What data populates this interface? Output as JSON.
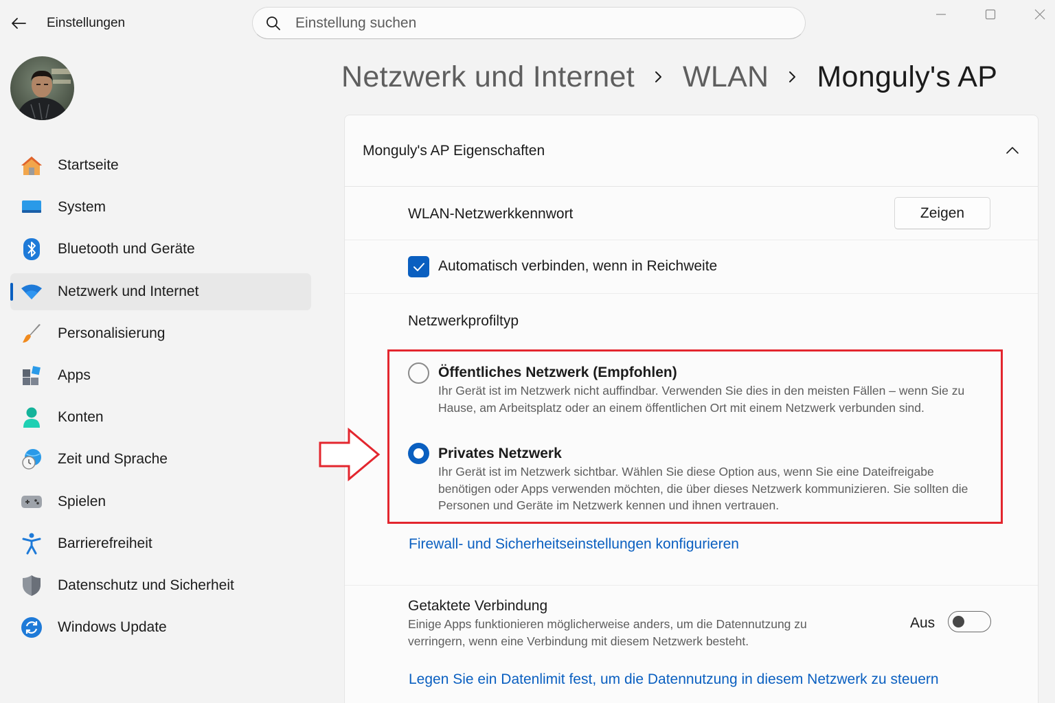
{
  "window": {
    "app_title": "Einstellungen",
    "search_placeholder": "Einstellung suchen"
  },
  "sidebar": {
    "items": [
      {
        "label": "Startseite",
        "icon": "home-icon"
      },
      {
        "label": "System",
        "icon": "system-icon"
      },
      {
        "label": "Bluetooth und Geräte",
        "icon": "bluetooth-icon"
      },
      {
        "label": "Netzwerk und Internet",
        "icon": "wifi-icon",
        "active": true
      },
      {
        "label": "Personalisierung",
        "icon": "brush-icon"
      },
      {
        "label": "Apps",
        "icon": "apps-icon"
      },
      {
        "label": "Konten",
        "icon": "account-icon"
      },
      {
        "label": "Zeit und Sprache",
        "icon": "clock-globe-icon"
      },
      {
        "label": "Spielen",
        "icon": "gamepad-icon"
      },
      {
        "label": "Barrierefreiheit",
        "icon": "accessibility-icon"
      },
      {
        "label": "Datenschutz und Sicherheit",
        "icon": "shield-icon"
      },
      {
        "label": "Windows Update",
        "icon": "update-icon"
      }
    ]
  },
  "breadcrumb": {
    "items": [
      "Netzwerk und Internet",
      "WLAN",
      "Monguly's AP"
    ]
  },
  "card": {
    "title": "Monguly's AP Eigenschaften",
    "password_label": "WLAN-Netzwerkkennwort",
    "show_button": "Zeigen",
    "auto_connect_label": "Automatisch verbinden, wenn in Reichweite",
    "auto_connect_checked": true,
    "profile_title": "Netzwerkprofiltyp",
    "options": [
      {
        "title": "Öffentliches Netzwerk (Empfohlen)",
        "description": "Ihr Gerät ist im Netzwerk nicht auffindbar. Verwenden Sie dies in den meisten Fällen – wenn Sie zu Hause, am Arbeitsplatz oder an einem öffentlichen Ort mit einem Netzwerk verbunden sind.",
        "selected": false
      },
      {
        "title": "Privates Netzwerk",
        "description": "Ihr Gerät ist im Netzwerk sichtbar. Wählen Sie diese Option aus, wenn Sie eine Dateifreigabe benötigen oder Apps verwenden möchten, die über dieses Netzwerk kommunizieren. Sie sollten die Personen und Geräte im Netzwerk kennen und ihnen vertrauen.",
        "selected": true
      }
    ],
    "firewall_link": "Firewall- und Sicherheitseinstellungen konfigurieren",
    "metered": {
      "title": "Getaktete Verbindung",
      "description": "Einige Apps funktionieren möglicherweise anders, um die Datennutzung zu verringern, wenn eine Verbindung mit diesem Netzwerk besteht.",
      "state_label": "Aus",
      "on": false
    },
    "data_limit_link": "Legen Sie ein Datenlimit fest, um die Datennutzung in diesem Netzwerk zu steuern"
  },
  "colors": {
    "accent": "#0a5fc0",
    "annotation": "#e3262e",
    "background": "#f3f3f3",
    "card": "#fbfbfb"
  }
}
